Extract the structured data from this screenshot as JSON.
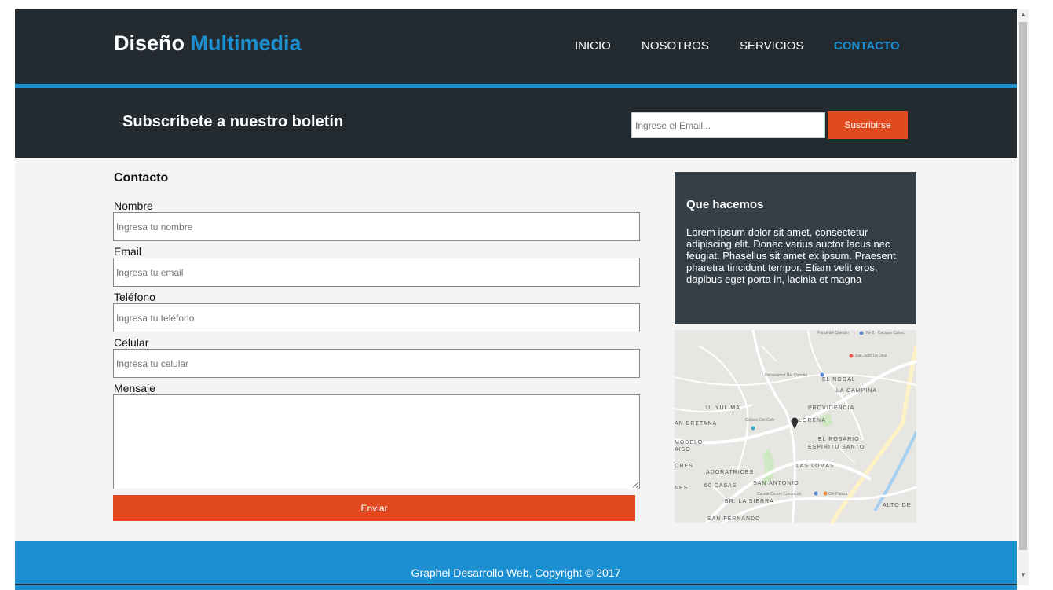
{
  "header": {
    "brand_primary": "Diseño",
    "brand_accent": "Multimedia",
    "nav": [
      "INICIO",
      "NOSOTROS",
      "SERVICIOS",
      "CONTACTO"
    ],
    "active_nav": "CONTACTO"
  },
  "newsletter": {
    "title": "Subscríbete a nuestro boletín",
    "email_placeholder": "Ingrese el Email...",
    "button": "Suscribirse"
  },
  "contact": {
    "title": "Contacto",
    "fields": [
      {
        "label": "Nombre",
        "placeholder": "Ingresa tu nombre"
      },
      {
        "label": "Email",
        "placeholder": "Ingresa tu email"
      },
      {
        "label": "Teléfono",
        "placeholder": "Ingresa tu teléfono"
      },
      {
        "label": "Celular",
        "placeholder": "Ingresa tu celular"
      }
    ],
    "message_label": "Mensaje",
    "submit": "Enviar"
  },
  "side": {
    "title": "Que hacemos",
    "text": "Lorem ipsum dolor sit amet, consectetur adipiscing elit. Donec varius auctor lacus nec feugiat. Phasellus sit amet ex ipsum. Praesent pharetra tincidunt tempor. Etiam velit eros, dapibus eget porta in, lacinia et magna"
  },
  "map": {
    "labels": [
      "EL NOGAL",
      "LA CAMPINA",
      "PROVIDENCIA",
      "U. YULIMA",
      "LORENA",
      "AN BRETANA",
      "EL ROSARIO",
      "ESPIRITU SANTO",
      "MODELO",
      "AISO",
      "LAS LOMAS",
      "ORES",
      "ADORATRICES",
      "60 CASAS",
      "SAN ANTONIO",
      "NES",
      "BR. LA SIERRA",
      "ALTO DE",
      "SAN FERNANDO"
    ],
    "pois": [
      "Portal del Quindío",
      "Nv 8 - Cacique Calarc",
      "San Juan De Dios",
      "Universidad Del Quindío",
      "Coliseo Del Café",
      "Calima Centro Comercial",
      "Olé Piazza"
    ]
  },
  "footer": {
    "text": "Graphel Desarrollo Web, Copyright © 2017"
  },
  "colors": {
    "dark": "#232a30",
    "accent_blue": "#1b8fd0",
    "accent_orange": "#e2491e",
    "side_box": "#343f48"
  }
}
